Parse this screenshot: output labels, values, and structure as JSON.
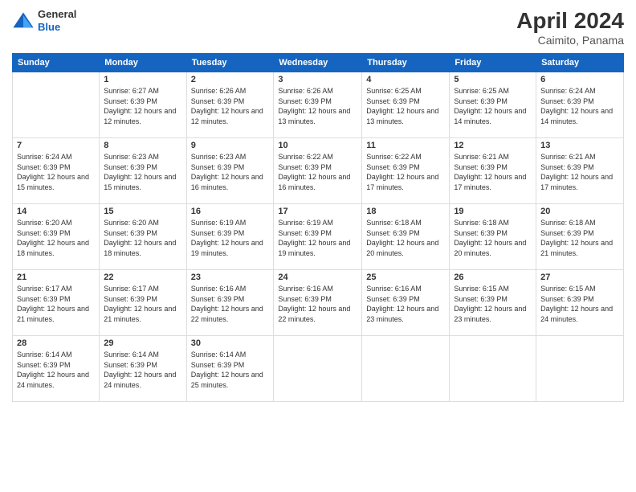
{
  "header": {
    "logo": {
      "general": "General",
      "blue": "Blue"
    },
    "title": "April 2024",
    "location": "Caimito, Panama"
  },
  "days_of_week": [
    "Sunday",
    "Monday",
    "Tuesday",
    "Wednesday",
    "Thursday",
    "Friday",
    "Saturday"
  ],
  "weeks": [
    [
      {
        "day": "",
        "info": ""
      },
      {
        "day": "1",
        "info": "Sunrise: 6:27 AM\nSunset: 6:39 PM\nDaylight: 12 hours\nand 12 minutes."
      },
      {
        "day": "2",
        "info": "Sunrise: 6:26 AM\nSunset: 6:39 PM\nDaylight: 12 hours\nand 12 minutes."
      },
      {
        "day": "3",
        "info": "Sunrise: 6:26 AM\nSunset: 6:39 PM\nDaylight: 12 hours\nand 13 minutes."
      },
      {
        "day": "4",
        "info": "Sunrise: 6:25 AM\nSunset: 6:39 PM\nDaylight: 12 hours\nand 13 minutes."
      },
      {
        "day": "5",
        "info": "Sunrise: 6:25 AM\nSunset: 6:39 PM\nDaylight: 12 hours\nand 14 minutes."
      },
      {
        "day": "6",
        "info": "Sunrise: 6:24 AM\nSunset: 6:39 PM\nDaylight: 12 hours\nand 14 minutes."
      }
    ],
    [
      {
        "day": "7",
        "info": "Sunrise: 6:24 AM\nSunset: 6:39 PM\nDaylight: 12 hours\nand 15 minutes."
      },
      {
        "day": "8",
        "info": "Sunrise: 6:23 AM\nSunset: 6:39 PM\nDaylight: 12 hours\nand 15 minutes."
      },
      {
        "day": "9",
        "info": "Sunrise: 6:23 AM\nSunset: 6:39 PM\nDaylight: 12 hours\nand 16 minutes."
      },
      {
        "day": "10",
        "info": "Sunrise: 6:22 AM\nSunset: 6:39 PM\nDaylight: 12 hours\nand 16 minutes."
      },
      {
        "day": "11",
        "info": "Sunrise: 6:22 AM\nSunset: 6:39 PM\nDaylight: 12 hours\nand 17 minutes."
      },
      {
        "day": "12",
        "info": "Sunrise: 6:21 AM\nSunset: 6:39 PM\nDaylight: 12 hours\nand 17 minutes."
      },
      {
        "day": "13",
        "info": "Sunrise: 6:21 AM\nSunset: 6:39 PM\nDaylight: 12 hours\nand 17 minutes."
      }
    ],
    [
      {
        "day": "14",
        "info": "Sunrise: 6:20 AM\nSunset: 6:39 PM\nDaylight: 12 hours\nand 18 minutes."
      },
      {
        "day": "15",
        "info": "Sunrise: 6:20 AM\nSunset: 6:39 PM\nDaylight: 12 hours\nand 18 minutes."
      },
      {
        "day": "16",
        "info": "Sunrise: 6:19 AM\nSunset: 6:39 PM\nDaylight: 12 hours\nand 19 minutes."
      },
      {
        "day": "17",
        "info": "Sunrise: 6:19 AM\nSunset: 6:39 PM\nDaylight: 12 hours\nand 19 minutes."
      },
      {
        "day": "18",
        "info": "Sunrise: 6:18 AM\nSunset: 6:39 PM\nDaylight: 12 hours\nand 20 minutes."
      },
      {
        "day": "19",
        "info": "Sunrise: 6:18 AM\nSunset: 6:39 PM\nDaylight: 12 hours\nand 20 minutes."
      },
      {
        "day": "20",
        "info": "Sunrise: 6:18 AM\nSunset: 6:39 PM\nDaylight: 12 hours\nand 21 minutes."
      }
    ],
    [
      {
        "day": "21",
        "info": "Sunrise: 6:17 AM\nSunset: 6:39 PM\nDaylight: 12 hours\nand 21 minutes."
      },
      {
        "day": "22",
        "info": "Sunrise: 6:17 AM\nSunset: 6:39 PM\nDaylight: 12 hours\nand 21 minutes."
      },
      {
        "day": "23",
        "info": "Sunrise: 6:16 AM\nSunset: 6:39 PM\nDaylight: 12 hours\nand 22 minutes."
      },
      {
        "day": "24",
        "info": "Sunrise: 6:16 AM\nSunset: 6:39 PM\nDaylight: 12 hours\nand 22 minutes."
      },
      {
        "day": "25",
        "info": "Sunrise: 6:16 AM\nSunset: 6:39 PM\nDaylight: 12 hours\nand 23 minutes."
      },
      {
        "day": "26",
        "info": "Sunrise: 6:15 AM\nSunset: 6:39 PM\nDaylight: 12 hours\nand 23 minutes."
      },
      {
        "day": "27",
        "info": "Sunrise: 6:15 AM\nSunset: 6:39 PM\nDaylight: 12 hours\nand 24 minutes."
      }
    ],
    [
      {
        "day": "28",
        "info": "Sunrise: 6:14 AM\nSunset: 6:39 PM\nDaylight: 12 hours\nand 24 minutes."
      },
      {
        "day": "29",
        "info": "Sunrise: 6:14 AM\nSunset: 6:39 PM\nDaylight: 12 hours\nand 24 minutes."
      },
      {
        "day": "30",
        "info": "Sunrise: 6:14 AM\nSunset: 6:39 PM\nDaylight: 12 hours\nand 25 minutes."
      },
      {
        "day": "",
        "info": ""
      },
      {
        "day": "",
        "info": ""
      },
      {
        "day": "",
        "info": ""
      },
      {
        "day": "",
        "info": ""
      }
    ]
  ]
}
